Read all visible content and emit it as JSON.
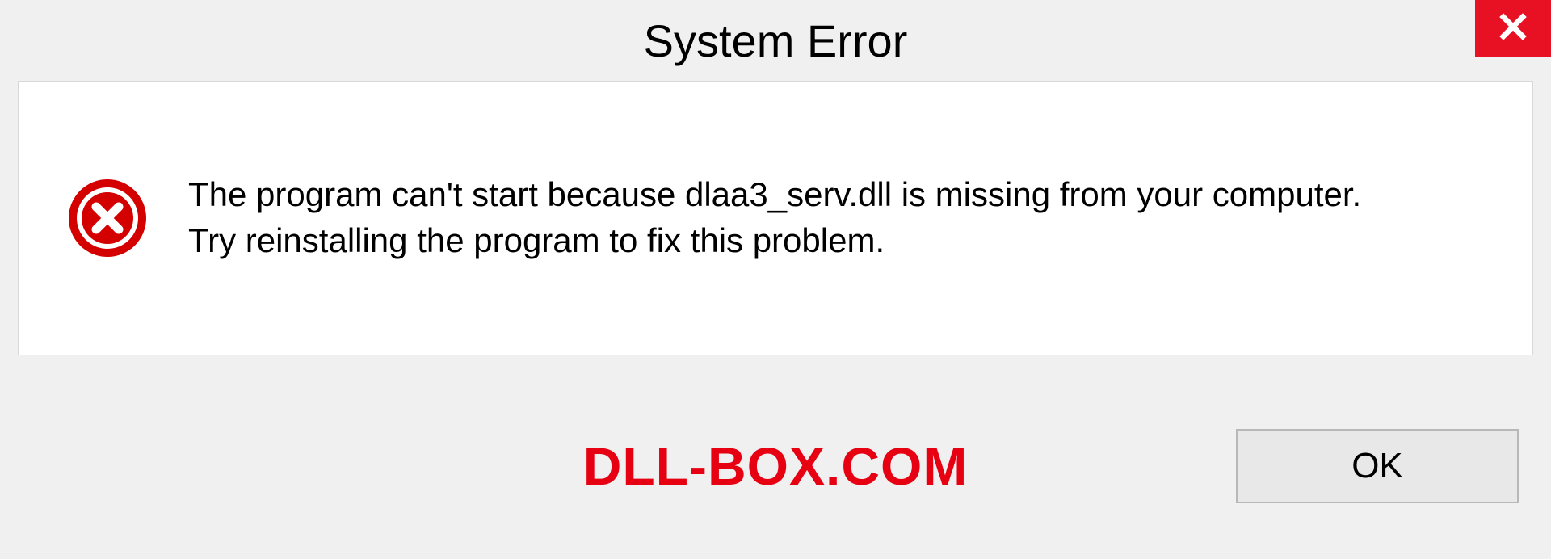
{
  "dialog": {
    "title": "System Error",
    "message": "The program can't start because dlaa3_serv.dll is missing from your computer. Try reinstalling the program to fix this problem.",
    "ok_label": "OK"
  },
  "watermark": "DLL-BOX.COM"
}
